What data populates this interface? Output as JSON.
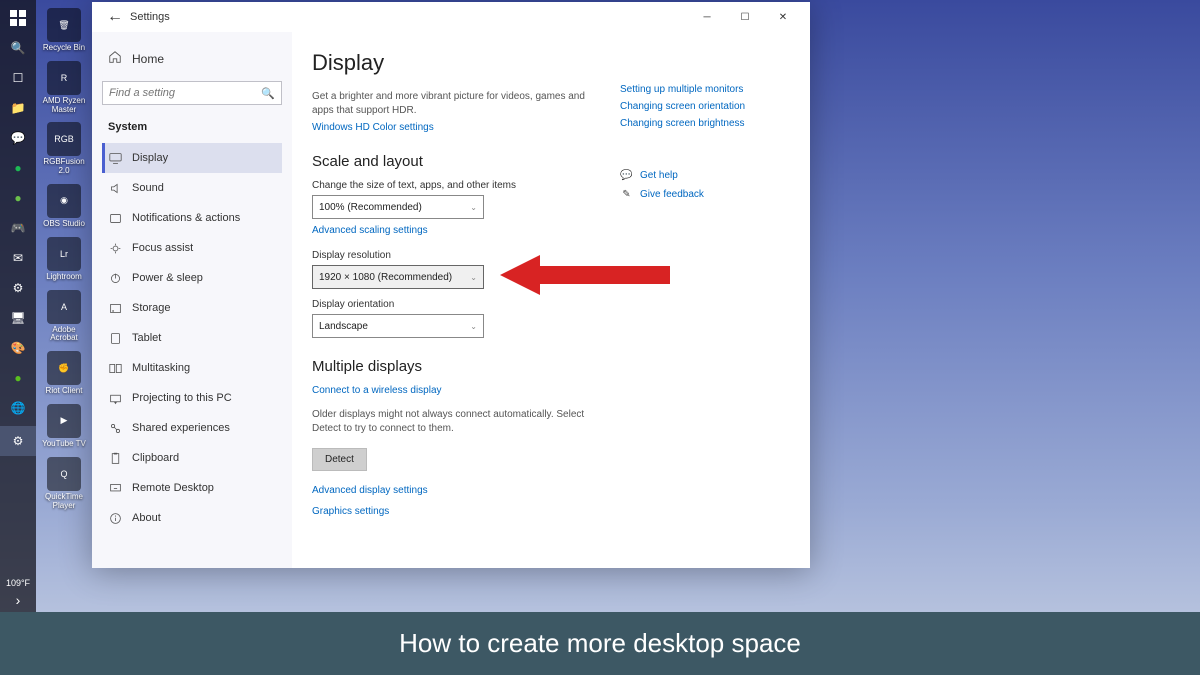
{
  "taskbar": {
    "temp": "109°F"
  },
  "desktop_icons": [
    {
      "label": "Recycle Bin",
      "glyph": "🗑"
    },
    {
      "label": "AMD Ryzen Master",
      "glyph": "R"
    },
    {
      "label": "RGBFusion 2.0",
      "glyph": "RGB"
    },
    {
      "label": "OBS Studio",
      "glyph": "◉"
    },
    {
      "label": "Lightroom",
      "glyph": "Lr"
    },
    {
      "label": "Adobe Acrobat",
      "glyph": "A"
    },
    {
      "label": "Riot Client",
      "glyph": "✊"
    },
    {
      "label": "YouTube TV",
      "glyph": "▶"
    },
    {
      "label": "QuickTime Player",
      "glyph": "Q"
    }
  ],
  "window": {
    "title": "Settings",
    "home": "Home",
    "search_placeholder": "Find a setting",
    "system_heading": "System"
  },
  "nav_items": [
    {
      "label": "Display",
      "active": true,
      "icon": "display"
    },
    {
      "label": "Sound",
      "active": false,
      "icon": "sound"
    },
    {
      "label": "Notifications & actions",
      "active": false,
      "icon": "notif"
    },
    {
      "label": "Focus assist",
      "active": false,
      "icon": "focus"
    },
    {
      "label": "Power & sleep",
      "active": false,
      "icon": "power"
    },
    {
      "label": "Storage",
      "active": false,
      "icon": "storage"
    },
    {
      "label": "Tablet",
      "active": false,
      "icon": "tablet"
    },
    {
      "label": "Multitasking",
      "active": false,
      "icon": "multi"
    },
    {
      "label": "Projecting to this PC",
      "active": false,
      "icon": "project"
    },
    {
      "label": "Shared experiences",
      "active": false,
      "icon": "shared"
    },
    {
      "label": "Clipboard",
      "active": false,
      "icon": "clipboard"
    },
    {
      "label": "Remote Desktop",
      "active": false,
      "icon": "remote"
    },
    {
      "label": "About",
      "active": false,
      "icon": "about"
    }
  ],
  "main": {
    "title": "Display",
    "hdr_desc": "Get a brighter and more vibrant picture for videos, games and apps that support HDR.",
    "hdr_link": "Windows HD Color settings",
    "scale_heading": "Scale and layout",
    "scale_label": "Change the size of text, apps, and other items",
    "scale_value": "100% (Recommended)",
    "adv_scaling": "Advanced scaling settings",
    "res_label": "Display resolution",
    "res_value": "1920 × 1080 (Recommended)",
    "orient_label": "Display orientation",
    "orient_value": "Landscape",
    "multi_heading": "Multiple displays",
    "wireless_link": "Connect to a wireless display",
    "detect_desc": "Older displays might not always connect automatically. Select Detect to try to connect to them.",
    "detect_btn": "Detect",
    "adv_display": "Advanced display settings",
    "graphics": "Graphics settings"
  },
  "right_links": [
    "Setting up multiple monitors",
    "Changing screen orientation",
    "Changing screen brightness"
  ],
  "right_help": {
    "get_help": "Get help",
    "feedback": "Give feedback"
  },
  "caption": "How to create more desktop space"
}
